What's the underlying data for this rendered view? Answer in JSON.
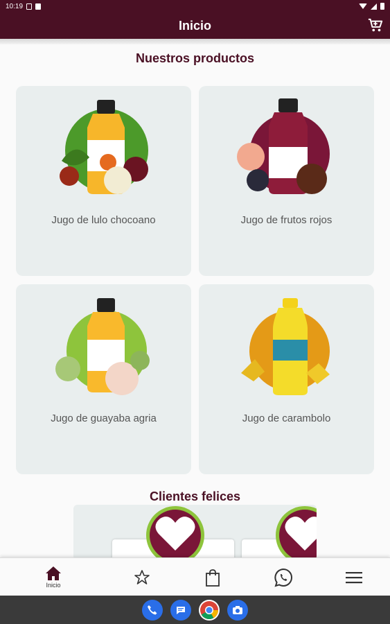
{
  "status_bar": {
    "time": "10:19"
  },
  "app_bar": {
    "title": "Inicio",
    "cart_icon": "cart-icon"
  },
  "sections": {
    "products_title": "Nuestros productos",
    "clients_title": "Clientes felices"
  },
  "products": [
    {
      "name": "Jugo de lulo chocoano",
      "bottle_color": "#f7b62a",
      "circle_color": "#4c9a2a"
    },
    {
      "name": "Jugo de frutos rojos",
      "bottle_color": "#8e1c3a",
      "circle_color": "#7a1638"
    },
    {
      "name": "Jugo de guayaba agria",
      "bottle_color": "#f9b92c",
      "circle_color": "#8ec43c"
    },
    {
      "name": "Jugo de carambolo",
      "bottle_color": "#f4dc2a",
      "circle_color": "#e49a17"
    }
  ],
  "bottom_nav": {
    "items": [
      {
        "label": "Inicio",
        "icon": "home-icon",
        "active": true
      },
      {
        "label": "",
        "icon": "star-icon"
      },
      {
        "label": "",
        "icon": "shopping-bag-icon"
      },
      {
        "label": "",
        "icon": "whatsapp-icon"
      },
      {
        "label": "",
        "icon": "menu-icon"
      }
    ]
  },
  "dock": [
    "phone-icon",
    "messages-icon",
    "chrome-icon",
    "camera-icon"
  ],
  "colors": {
    "primary": "#4a1024",
    "card_bg": "#e9eeee",
    "accent_green": "#8ec43c"
  }
}
